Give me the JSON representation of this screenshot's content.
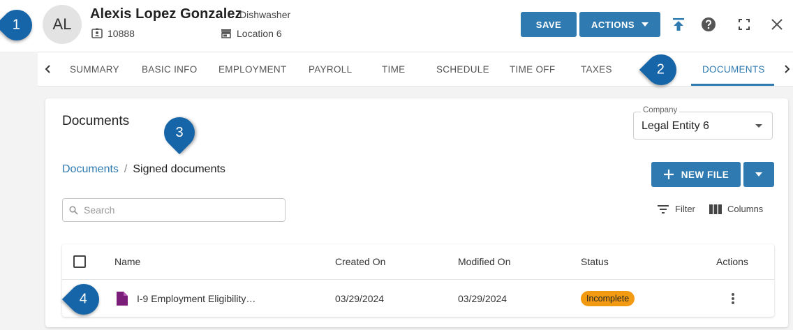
{
  "employee": {
    "initials": "AL",
    "name": "Alexis Lopez Gonzalez",
    "role": "Dishwasher",
    "id": "10888",
    "location": "Location 6"
  },
  "toolbar": {
    "save_label": "SAVE",
    "actions_label": "ACTIONS"
  },
  "tabs": [
    {
      "label": "SUMMARY"
    },
    {
      "label": "BASIC INFO"
    },
    {
      "label": "EMPLOYMENT"
    },
    {
      "label": "PAYROLL"
    },
    {
      "label": "TIME"
    },
    {
      "label": "SCHEDULE"
    },
    {
      "label": "TIME OFF"
    },
    {
      "label": "TAXES"
    },
    {
      "label": "DOCUMENTS",
      "active": true
    }
  ],
  "documents": {
    "title": "Documents",
    "company_label": "Company",
    "company_value": "Legal Entity 6",
    "breadcrumb": {
      "root": "Documents",
      "separator": "/",
      "current": "Signed documents"
    },
    "new_file_label": "NEW FILE",
    "search_placeholder": "Search",
    "filter_label": "Filter",
    "columns_label": "Columns",
    "table": {
      "headers": {
        "name": "Name",
        "created": "Created On",
        "modified": "Modified On",
        "status": "Status",
        "actions": "Actions"
      },
      "rows": [
        {
          "name": "I-9 Employment Eligibility…",
          "created": "03/29/2024",
          "modified": "03/29/2024",
          "status": "Incomplete"
        }
      ]
    }
  },
  "callouts": [
    "1",
    "2",
    "3",
    "4"
  ],
  "colors": {
    "accent": "#2f7ab0",
    "status_incomplete": "#f29b12",
    "callout": "#1565a8",
    "file_icon": "#7b1e7a"
  }
}
